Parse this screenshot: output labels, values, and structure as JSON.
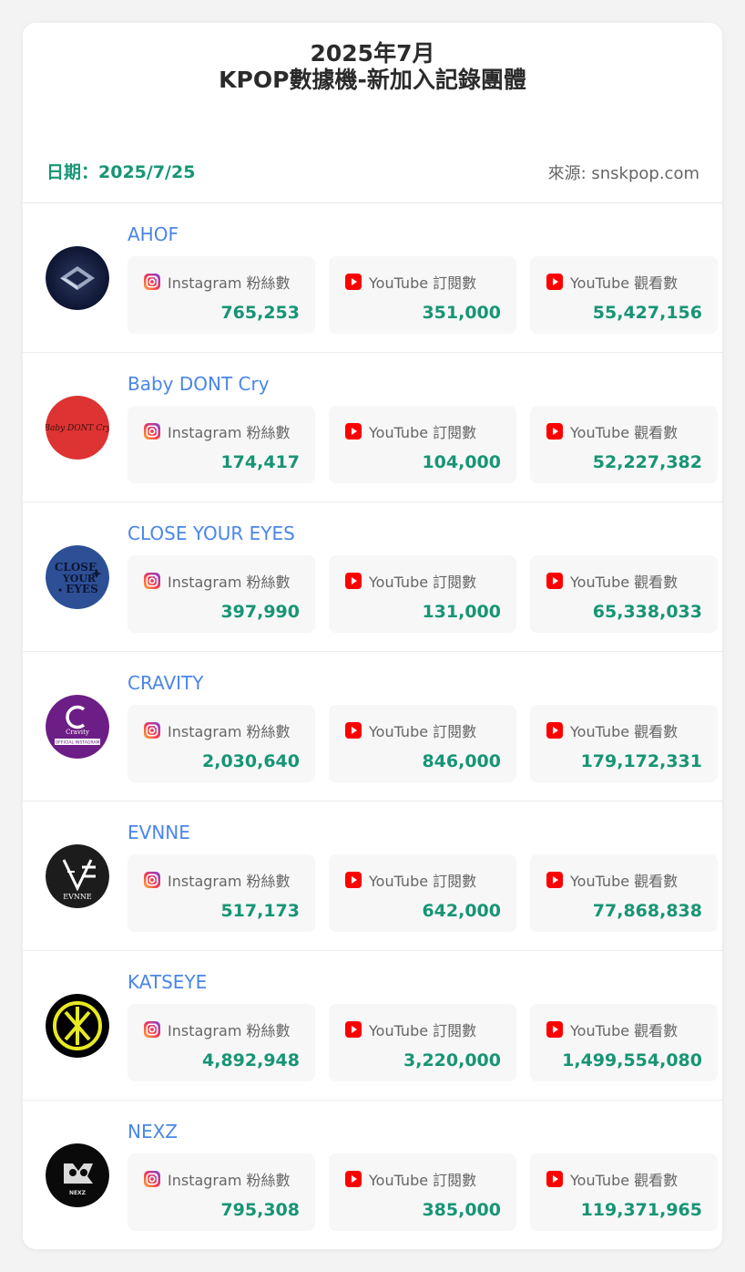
{
  "title": {
    "line1": "2025年7月",
    "line2": "KPOP數據機-新加入記錄團體"
  },
  "meta": {
    "date": "日期：2025/7/25",
    "source": "來源: snskpop.com"
  },
  "labels": {
    "instagram": "Instagram 粉絲數",
    "yt_subs": "YouTube 訂閱數",
    "yt_views": "YouTube 觀看數"
  },
  "colors": {
    "accent_green": "#179575",
    "name_blue": "#4a86e8",
    "youtube_red": "#ff0000"
  },
  "groups": [
    {
      "name": "AHOF",
      "logo": "ahof-logo",
      "logo_text": "",
      "instagram": "765,253",
      "yt_subs": "351,000",
      "yt_views": "55,427,156"
    },
    {
      "name": "Baby DONT Cry",
      "logo": "baby-dont-cry-logo",
      "logo_text": "Baby DONT Cry",
      "instagram": "174,417",
      "yt_subs": "104,000",
      "yt_views": "52,227,382"
    },
    {
      "name": "CLOSE YOUR EYES",
      "logo": "close-your-eyes-logo",
      "logo_text": "CLOSE YOUR EYES",
      "instagram": "397,990",
      "yt_subs": "131,000",
      "yt_views": "65,338,033"
    },
    {
      "name": "CRAVITY",
      "logo": "cravity-logo",
      "logo_text": "OFFICIAL INSTAGRAM",
      "instagram": "2,030,640",
      "yt_subs": "846,000",
      "yt_views": "179,172,331"
    },
    {
      "name": "EVNNE",
      "logo": "evnne-logo",
      "logo_text": "EVNNE",
      "instagram": "517,173",
      "yt_subs": "642,000",
      "yt_views": "77,868,838"
    },
    {
      "name": "KATSEYE",
      "logo": "katseye-logo",
      "logo_text": "",
      "instagram": "4,892,948",
      "yt_subs": "3,220,000",
      "yt_views": "1,499,554,080"
    },
    {
      "name": "NEXZ",
      "logo": "nexz-logo",
      "logo_text": "NEXZ",
      "instagram": "795,308",
      "yt_subs": "385,000",
      "yt_views": "119,371,965"
    }
  ]
}
